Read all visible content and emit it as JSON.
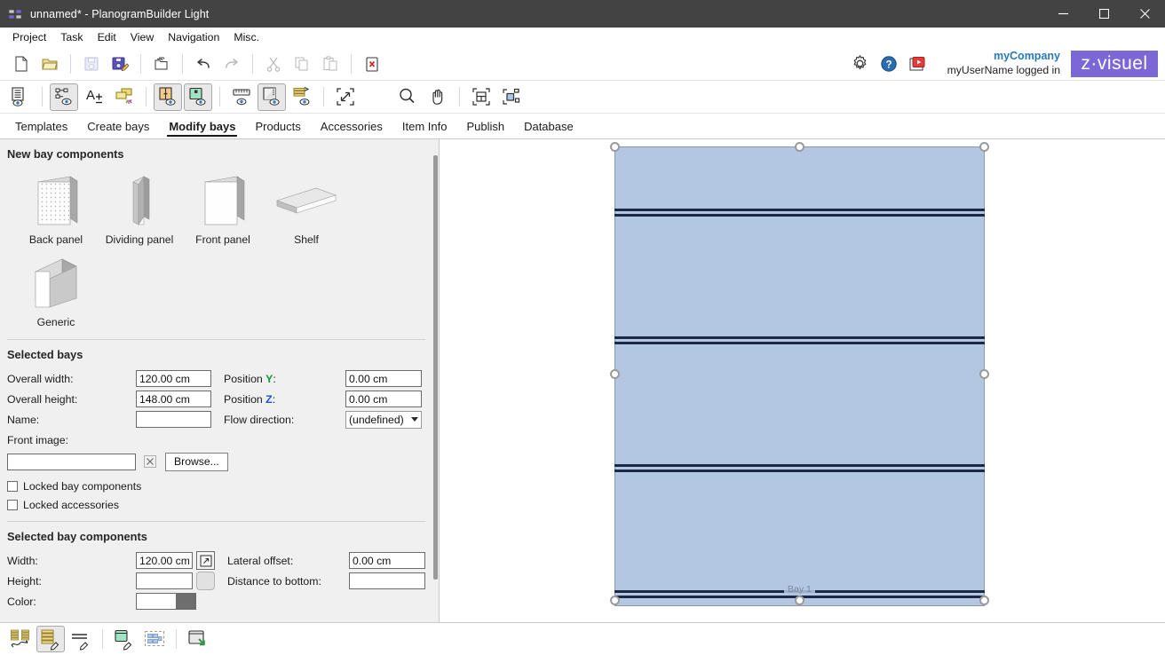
{
  "window": {
    "title": "unnamed* - PlanogramBuilder Light",
    "app_icon": "planogram-app-icon",
    "minimize": "minimize-icon",
    "maximize": "maximize-icon",
    "close": "close-icon"
  },
  "menubar": {
    "items": [
      {
        "label": "Project"
      },
      {
        "label": "Task"
      },
      {
        "label": "Edit"
      },
      {
        "label": "View"
      },
      {
        "label": "Navigation"
      },
      {
        "label": "Misc."
      }
    ]
  },
  "toolbar_file": {
    "buttons": [
      {
        "name": "new-document-button",
        "icon": "new-document-icon",
        "enabled": true
      },
      {
        "name": "open-folder-button",
        "icon": "open-folder-icon",
        "enabled": true
      },
      {
        "name": "save-button",
        "icon": "save-icon",
        "enabled": false
      },
      {
        "name": "save-as-button",
        "icon": "save-as-icon",
        "enabled": true
      },
      {
        "name": "copy-project-button",
        "icon": "copy-project-icon",
        "enabled": true
      },
      {
        "name": "undo-button",
        "icon": "undo-icon",
        "enabled": true
      },
      {
        "name": "redo-button",
        "icon": "redo-icon",
        "enabled": false
      },
      {
        "name": "cut-button",
        "icon": "scissors-icon",
        "enabled": false
      },
      {
        "name": "copy-button",
        "icon": "copy-icon",
        "enabled": false
      },
      {
        "name": "paste-button",
        "icon": "paste-icon",
        "enabled": false
      },
      {
        "name": "delete-button",
        "icon": "delete-icon",
        "enabled": true
      }
    ],
    "settings_icon": "gear-icon",
    "help_icon": "help-icon",
    "video_icon": "video-icon"
  },
  "account": {
    "company": "myCompany",
    "status": "myUserName logged in",
    "brand": "z·visuel"
  },
  "toolbar_view": {
    "buttons": [
      {
        "name": "show-list-button",
        "icon": "list-view-icon",
        "pressed": false
      },
      {
        "name": "show-structure-button",
        "icon": "structure-view-icon",
        "pressed": true
      },
      {
        "name": "text-size-button",
        "icon": "text-size-icon",
        "pressed": false
      },
      {
        "name": "show-labels-button",
        "icon": "labels-icon",
        "pressed": false
      },
      {
        "name": "show-front-panels-button",
        "icon": "front-panel-view-icon",
        "pressed": true
      },
      {
        "name": "show-products-button",
        "icon": "product-view-icon",
        "pressed": true
      },
      {
        "name": "show-measurements-button",
        "icon": "ruler-icon",
        "pressed": false
      },
      {
        "name": "show-shadows-button",
        "icon": "shadow-view-icon",
        "pressed": true
      },
      {
        "name": "show-stack-button",
        "icon": "stack-view-icon",
        "pressed": false
      },
      {
        "name": "zoom-fit-button",
        "icon": "zoom-fit-icon",
        "pressed": false
      },
      {
        "name": "zoom-tool-button",
        "icon": "magnifier-icon",
        "pressed": false
      },
      {
        "name": "pan-tool-button",
        "icon": "hand-icon",
        "pressed": false
      },
      {
        "name": "zoom-to-bay-button",
        "icon": "zoom-to-bay-icon",
        "pressed": false
      },
      {
        "name": "zoom-to-item-button",
        "icon": "zoom-to-item-icon",
        "pressed": false
      }
    ]
  },
  "tabs": {
    "items": [
      {
        "label": "Templates",
        "active": false
      },
      {
        "label": "Create bays",
        "active": false
      },
      {
        "label": "Modify bays",
        "active": true
      },
      {
        "label": "Products",
        "active": false
      },
      {
        "label": "Accessories",
        "active": false
      },
      {
        "label": "Item Info",
        "active": false
      },
      {
        "label": "Publish",
        "active": false
      },
      {
        "label": "Database",
        "active": false
      }
    ]
  },
  "new_bay_components": {
    "title": "New bay components",
    "items": [
      {
        "label": "Back panel",
        "icon": "back-panel-3d-icon"
      },
      {
        "label": "Dividing panel",
        "icon": "dividing-panel-3d-icon"
      },
      {
        "label": "Front panel",
        "icon": "front-panel-3d-icon"
      },
      {
        "label": "Shelf",
        "icon": "shelf-3d-icon"
      },
      {
        "label": "Generic",
        "icon": "generic-cube-3d-icon"
      }
    ]
  },
  "selected_bays": {
    "title": "Selected bays",
    "overall_width_label": "Overall width:",
    "overall_width_value": "120.00 cm",
    "overall_height_label": "Overall height:",
    "overall_height_value": "148.00 cm",
    "name_label": "Name:",
    "name_value": "",
    "position_y_label": "Position ",
    "position_y_axis": "Y",
    "position_y_colon": ":",
    "position_y_value": "0.00 cm",
    "position_z_label": "Position ",
    "position_z_axis": "Z",
    "position_z_colon": ":",
    "position_z_value": "0.00 cm",
    "flow_direction_label": "Flow direction:",
    "flow_direction_value": "(undefined)",
    "front_image_label": "Front image:",
    "front_image_value": "",
    "clear_icon": "clear-x-icon",
    "browse_label": "Browse...",
    "locked_bay_components_label": "Locked bay components",
    "locked_bay_components_checked": false,
    "locked_accessories_label": "Locked accessories",
    "locked_accessories_checked": false
  },
  "selected_bay_components": {
    "title": "Selected bay components",
    "width_label": "Width:",
    "width_value": "120.00 cm",
    "width_link_icon": "expand-link-icon",
    "height_label": "Height:",
    "height_value": "",
    "height_extra_icon": "rounded-disabled-button",
    "color_label": "Color:",
    "color_value": "#ffffff",
    "color_dropdown_icon": "color-dropdown-icon",
    "lateral_offset_label": "Lateral offset:",
    "lateral_offset_value": "0.00 cm",
    "distance_to_bottom_label": "Distance to bottom:",
    "distance_to_bottom_value": ""
  },
  "canvas": {
    "bay_label": "Bay 1",
    "bay_fill_color": "#b4c7e2",
    "shelf_color": "#1b2a44",
    "handle_count": 8
  },
  "bottom_toolbar": {
    "buttons": [
      {
        "name": "move-bays-button",
        "icon": "move-bays-icon",
        "pressed": false
      },
      {
        "name": "edit-bays-button",
        "icon": "edit-bays-icon",
        "pressed": true
      },
      {
        "name": "edit-shelves-button",
        "icon": "edit-shelves-icon",
        "pressed": false
      },
      {
        "name": "edit-products-button",
        "icon": "edit-products-icon",
        "pressed": false
      },
      {
        "name": "select-area-button",
        "icon": "select-area-icon",
        "pressed": false
      },
      {
        "name": "export-view-button",
        "icon": "export-view-icon",
        "pressed": false
      }
    ]
  }
}
